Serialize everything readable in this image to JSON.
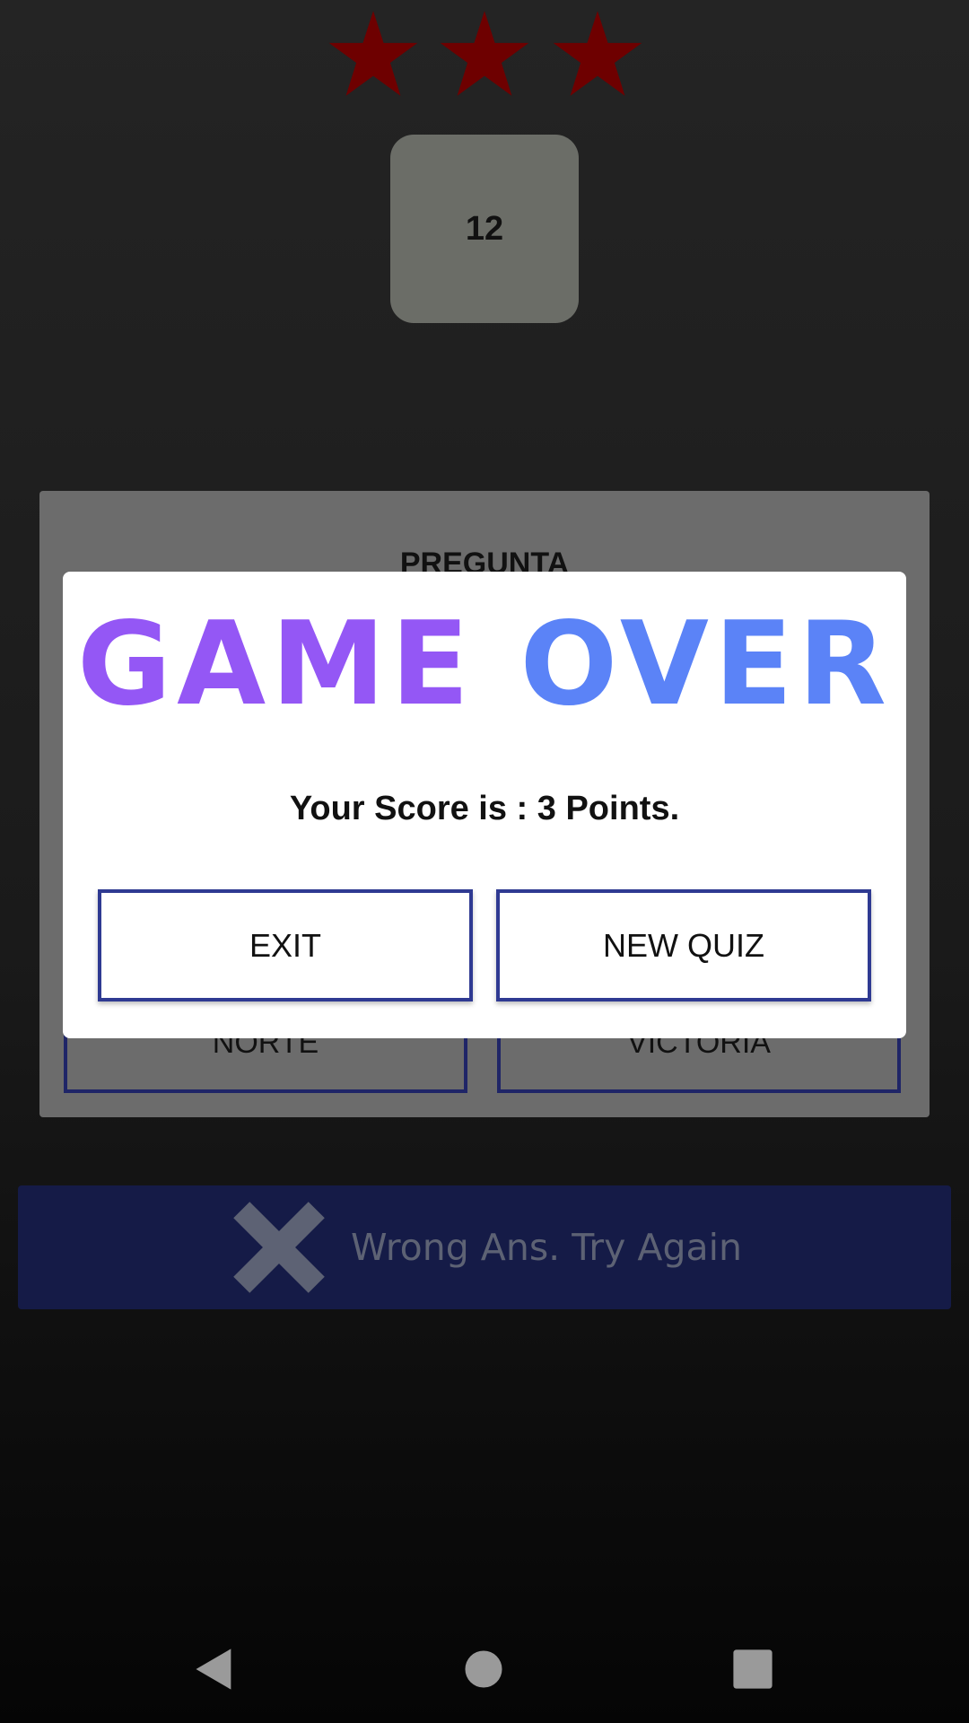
{
  "stars": {
    "total": 3,
    "lit": 3,
    "color": "#6e0000"
  },
  "timer": {
    "value": "12"
  },
  "question": {
    "title": "PREGUNTA",
    "answers": [
      "NORTE",
      "VICTORIA"
    ]
  },
  "feedback": {
    "icon": "close-icon",
    "text": "Wrong Ans. Try Again"
  },
  "dialog": {
    "title_word_1": "GAME",
    "title_word_2": "OVER",
    "title_color_1": "#9457f5",
    "title_color_2": "#5b83f7",
    "score_text": "Your Score is : 3 Points.",
    "exit_label": "EXIT",
    "new_quiz_label": "NEW QUIZ"
  },
  "navbar": {
    "icons": [
      "back-icon",
      "home-icon",
      "recents-icon"
    ]
  }
}
